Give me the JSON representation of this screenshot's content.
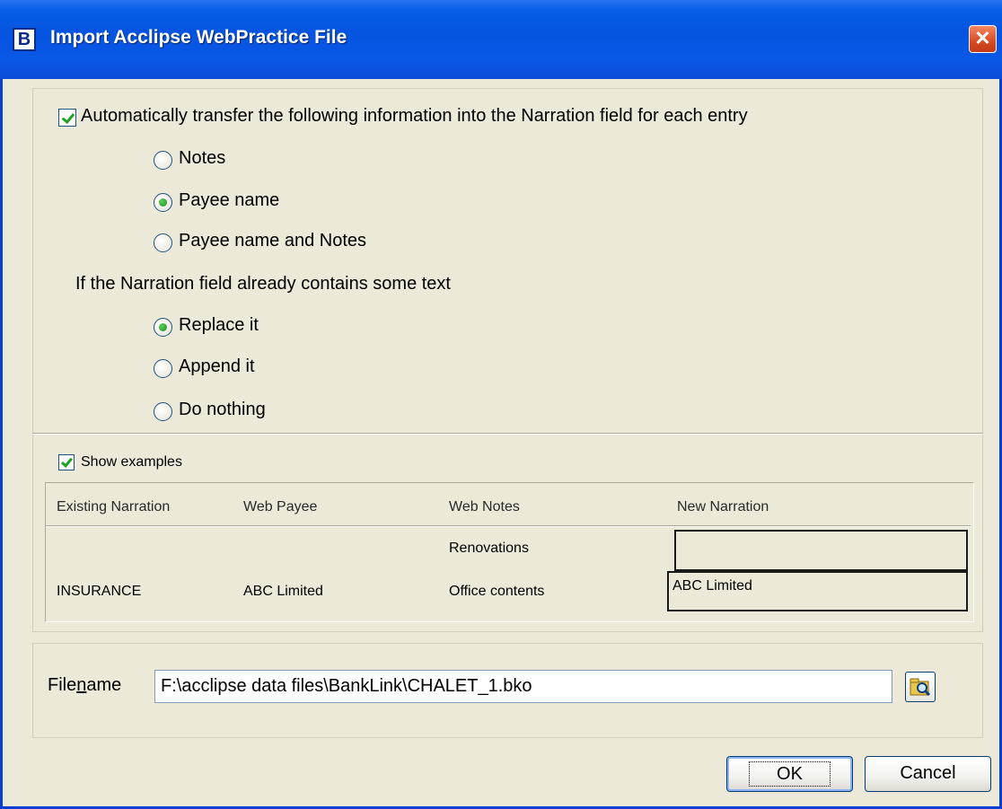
{
  "window": {
    "title": "Import Acclipse WebPractice File",
    "icon_letter": "B"
  },
  "narration": {
    "auto_transfer_label": "Automatically transfer the following information into the Narration field for each entry",
    "auto_transfer_checked": true,
    "source_options": [
      "Notes",
      "Payee name",
      "Payee name and Notes"
    ],
    "source_selected": "Payee name",
    "existing_text_label": "If the Narration field already contains some text",
    "existing_options": [
      "Replace it",
      "Append it",
      "Do nothing"
    ],
    "existing_selected": "Replace it"
  },
  "examples": {
    "show_label": "Show examples",
    "show_checked": true,
    "columns": [
      "Existing Narration",
      "Web Payee",
      "Web Notes",
      "New Narration"
    ],
    "rows": [
      [
        "",
        "",
        "Renovations",
        ""
      ],
      [
        "INSURANCE",
        "ABC Limited",
        "Office contents",
        "ABC Limited"
      ]
    ]
  },
  "file": {
    "label": "Filename",
    "value": "F:\\acclipse data files\\BankLink\\CHALET_1.bko"
  },
  "buttons": {
    "ok": "OK",
    "cancel": "Cancel"
  }
}
